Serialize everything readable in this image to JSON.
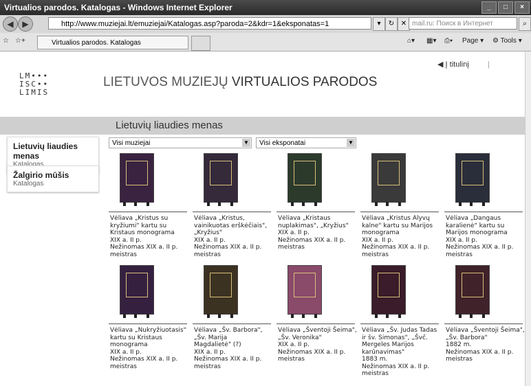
{
  "window": {
    "title": "Virtualios parodos. Katalogas - Windows Internet Explorer"
  },
  "addressbar": {
    "url": "http://www.muziejai.lt/emuziejai/Katalogas.asp?paroda=2&kdr=1&eksponatas=1",
    "search_placeholder": "mail.ru: Поиск в Интернет"
  },
  "tabs": {
    "active": "Virtualios parodos. Katalogas"
  },
  "commands": {
    "page": "Page",
    "tools": "Tools"
  },
  "header": {
    "logo_lines": [
      "LM•••",
      "ISC••",
      "LIMIS"
    ],
    "title_light": "LIETUVOS MUZIEJŲ",
    "title_dark": "VIRTUALIOS PARODOS",
    "home_link": "Į titulinį"
  },
  "section_title": "Lietuvių liaudies menas",
  "sidebar": [
    {
      "title": "Lietuvių liaudies menas",
      "subtitle": "Katalogas"
    },
    {
      "title": "Žalgirio mūšis",
      "subtitle": "Katalogas"
    }
  ],
  "filters": {
    "museum": "Visi muziejai",
    "exhibits": "Visi eksponatai"
  },
  "items": [
    {
      "lines": [
        "Vėliava „Kristus su",
        "kryžiumi\" kartu su",
        "Kristaus monograma",
        "XIX a. II p.",
        "Nežinomas XIX a. II p.",
        "meistras"
      ],
      "color": "#3a2340"
    },
    {
      "lines": [
        "Vėliava „Kristus,",
        "vainikuotas erškėčiais\",",
        "„Kryžius\"",
        "XIX a. II p.",
        "Nežinomas XIX a. II p.",
        "meistras"
      ],
      "color": "#342a3a"
    },
    {
      "lines": [
        "Vėliava „Kristaus",
        "nuplakimas\", „Kryžius\"",
        "XIX a. II p.",
        "Nežinomas XIX a. II p.",
        "meistras"
      ],
      "color": "#2c3a2c"
    },
    {
      "lines": [
        "Vėliava „Kristus Alyvų",
        "kalne\" kartu su Marijos",
        "monograma",
        "XIX a. II p.",
        "Nežinomas XIX a. II p.",
        "meistras"
      ],
      "color": "#3a3a3a"
    },
    {
      "lines": [
        "Vėliava „Dangaus",
        "karalienė\" kartu su",
        "Marijos monograma",
        "XIX a. II p.",
        "Nežinomas XIX a. II p.",
        "meistras"
      ],
      "color": "#2a2e3a"
    },
    {
      "lines": [
        "Vėliava „Nukryžiuotasis\"",
        "kartu su Kristaus",
        "monograma",
        "XIX a. II p.",
        "Nežinomas XIX a. II p.",
        "meistras"
      ],
      "color": "#362040"
    },
    {
      "lines": [
        "Vėliava „Šv. Barbora\",",
        "„Šv. Marija",
        "Magdalietė\" (?)",
        "XIX a. II p.",
        "Nežinomas XIX a. II p.",
        "meistras"
      ],
      "color": "#3c3222"
    },
    {
      "lines": [
        "Vėliava „Šventoji Šeima\",",
        "„Šv. Veronika\"",
        "XIX a. II p.",
        "Nežinomas XIX a. II p.",
        "meistras"
      ],
      "color": "#8a4a6a"
    },
    {
      "lines": [
        "Vėliava „Šv. Judas Tadas",
        "ir šv. Simonas\", „Švč.",
        "Mergeles Marijos",
        "karūnavimas\"",
        "1883 m.",
        "Nežinomas XIX a. II p.",
        "meistras"
      ],
      "color": "#3a1c2a"
    },
    {
      "lines": [
        "Vėliava „Šventoji Šeima\",",
        "„Šv. Barbora\"",
        "1882 m.",
        "Nežinomas XIX a. II p.",
        "meistras"
      ],
      "color": "#40222a"
    }
  ]
}
